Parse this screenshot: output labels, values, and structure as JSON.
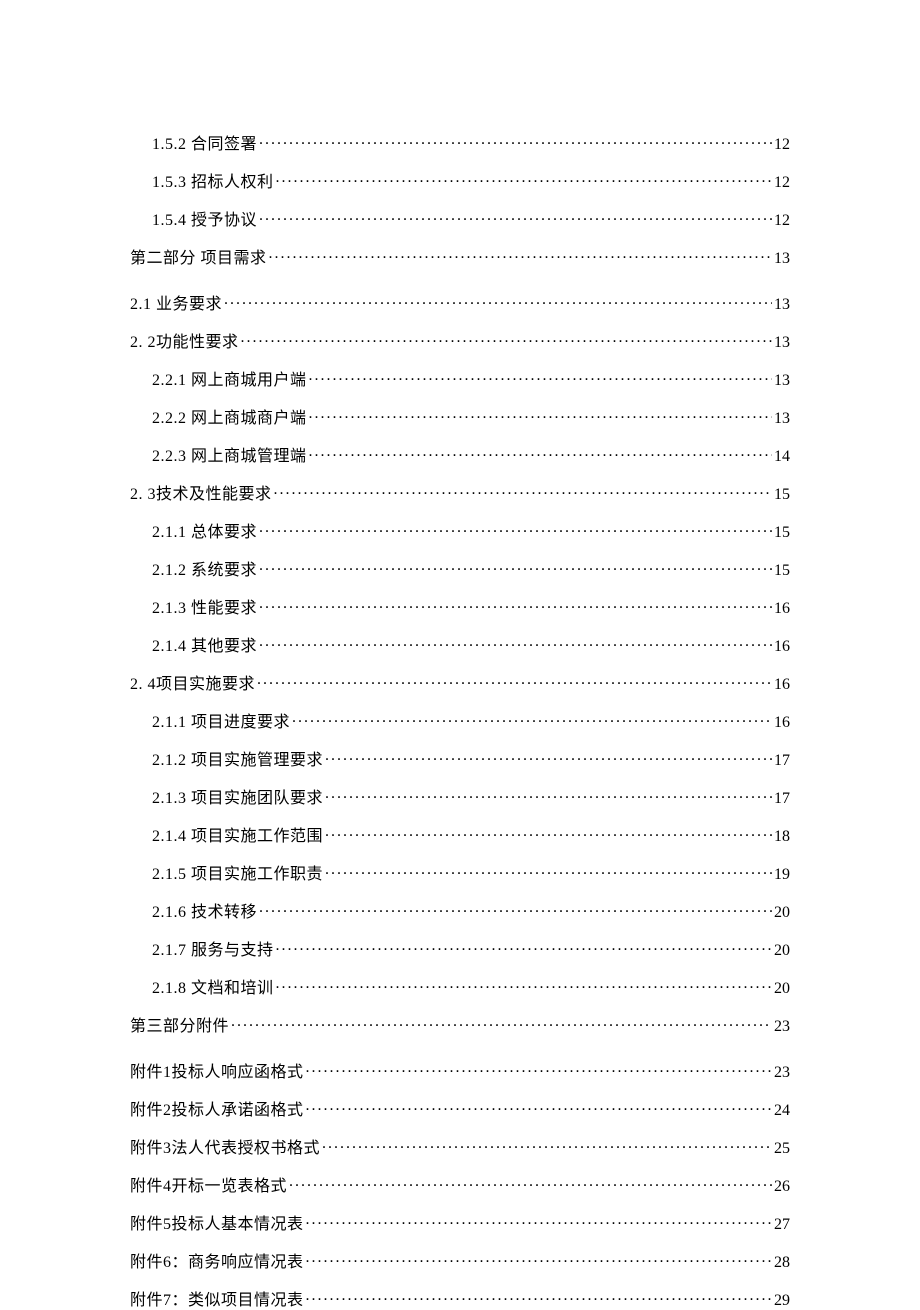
{
  "toc": [
    {
      "label": "1.5.2 合同签署",
      "page": "12",
      "indent": 1,
      "spaced": false
    },
    {
      "label": "1.5.3 招标人权利",
      "page": "12",
      "indent": 1,
      "spaced": false
    },
    {
      "label": "1.5.4 授予协议",
      "page": "12",
      "indent": 1,
      "spaced": false
    },
    {
      "label": "第二部分 项目需求",
      "page": "13",
      "indent": 0,
      "spaced": false
    },
    {
      "label": "2.1 业务要求",
      "page": "13",
      "indent": 0,
      "spaced": true
    },
    {
      "label": "2. 2功能性要求",
      "page": "13",
      "indent": 0,
      "spaced": false
    },
    {
      "label": "2.2.1 网上商城用户端",
      "page": "13",
      "indent": 1,
      "spaced": false
    },
    {
      "label": "2.2.2 网上商城商户端",
      "page": "13",
      "indent": 1,
      "spaced": false
    },
    {
      "label": "2.2.3 网上商城管理端",
      "page": "14",
      "indent": 1,
      "spaced": false
    },
    {
      "label": "2. 3技术及性能要求",
      "page": "15",
      "indent": 0,
      "spaced": false
    },
    {
      "label": "2.1.1 总体要求",
      "page": "15",
      "indent": 1,
      "spaced": false
    },
    {
      "label": "2.1.2 系统要求",
      "page": "15",
      "indent": 1,
      "spaced": false
    },
    {
      "label": "2.1.3 性能要求",
      "page": "16",
      "indent": 1,
      "spaced": false
    },
    {
      "label": "2.1.4 其他要求",
      "page": "16",
      "indent": 1,
      "spaced": false
    },
    {
      "label": "2. 4项目实施要求",
      "page": "16",
      "indent": 0,
      "spaced": false
    },
    {
      "label": "2.1.1 项目进度要求",
      "page": "16",
      "indent": 1,
      "spaced": false
    },
    {
      "label": "2.1.2 项目实施管理要求",
      "page": "17",
      "indent": 1,
      "spaced": false
    },
    {
      "label": "2.1.3 项目实施团队要求",
      "page": "17",
      "indent": 1,
      "spaced": false
    },
    {
      "label": "2.1.4 项目实施工作范围",
      "page": "18",
      "indent": 1,
      "spaced": false
    },
    {
      "label": "2.1.5 项目实施工作职责",
      "page": "19",
      "indent": 1,
      "spaced": false
    },
    {
      "label": "2.1.6 技术转移",
      "page": "20",
      "indent": 1,
      "spaced": false
    },
    {
      "label": "2.1.7 服务与支持",
      "page": "20",
      "indent": 1,
      "spaced": false
    },
    {
      "label": "2.1.8 文档和培训",
      "page": "20",
      "indent": 1,
      "spaced": false
    },
    {
      "label": "第三部分附件",
      "page": "23",
      "indent": 0,
      "spaced": false
    },
    {
      "label": "附件1投标人响应函格式",
      "page": "23",
      "indent": 0,
      "spaced": true
    },
    {
      "label": "附件2投标人承诺函格式",
      "page": "24",
      "indent": 0,
      "spaced": false
    },
    {
      "label": "附件3法人代表授权书格式",
      "page": "25",
      "indent": 0,
      "spaced": false
    },
    {
      "label": "附件4开标一览表格式",
      "page": "26",
      "indent": 0,
      "spaced": false
    },
    {
      "label": "附件5投标人基本情况表",
      "page": "27",
      "indent": 0,
      "spaced": false
    },
    {
      "label": "附件6：商务响应情况表",
      "page": "28",
      "indent": 0,
      "spaced": false
    },
    {
      "label": "附件7：类似项目情况表",
      "page": "29",
      "indent": 0,
      "spaced": false
    }
  ]
}
